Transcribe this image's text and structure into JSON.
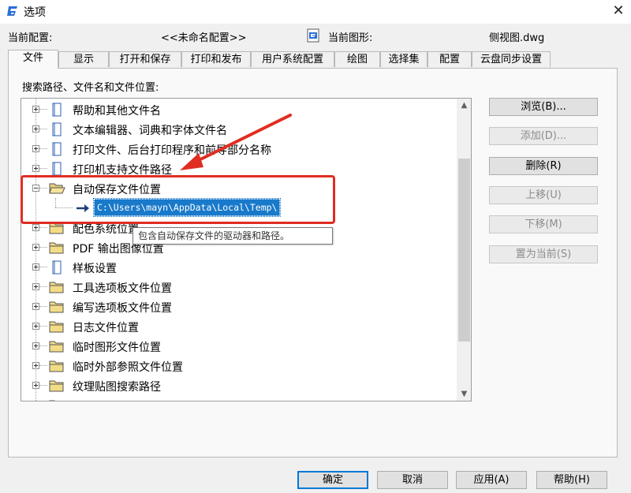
{
  "window": {
    "title": "选项",
    "close_label": "✕"
  },
  "header": {
    "current_profile_label": "当前配置:",
    "current_profile_value": "<<未命名配置>>",
    "current_drawing_label": "当前图形:",
    "current_drawing_value": "侧视图.dwg"
  },
  "tabs": [
    {
      "label": "文件"
    },
    {
      "label": "显示"
    },
    {
      "label": "打开和保存"
    },
    {
      "label": "打印和发布"
    },
    {
      "label": "用户系统配置"
    },
    {
      "label": "绘图"
    },
    {
      "label": "选择集"
    },
    {
      "label": "配置"
    },
    {
      "label": "云盘同步设置"
    }
  ],
  "files": {
    "section_label": "搜索路径、文件名和文件位置:",
    "tree": [
      {
        "label": "帮助和其他文件名",
        "icon": "document-icon",
        "expanded": false
      },
      {
        "label": "文本编辑器、词典和字体文件名",
        "icon": "document-icon",
        "expanded": false
      },
      {
        "label": "打印文件、后台打印程序和前导部分名称",
        "icon": "document-icon",
        "expanded": false
      },
      {
        "label": "打印机支持文件路径",
        "icon": "document-icon",
        "expanded": false
      },
      {
        "label": "自动保存文件位置",
        "icon": "folder-open-icon",
        "expanded": true
      },
      {
        "label": "配色系统位置",
        "icon": "folder-icon",
        "expanded": false
      },
      {
        "label": "PDF 输出图像位置",
        "icon": "folder-icon",
        "expanded": false
      },
      {
        "label": "样板设置",
        "icon": "document-icon",
        "expanded": false
      },
      {
        "label": "工具选项板文件位置",
        "icon": "folder-icon",
        "expanded": false
      },
      {
        "label": "编写选项板文件位置",
        "icon": "folder-icon",
        "expanded": false
      },
      {
        "label": "日志文件位置",
        "icon": "folder-icon",
        "expanded": false
      },
      {
        "label": "临时图形文件位置",
        "icon": "folder-icon",
        "expanded": false
      },
      {
        "label": "临时外部参照文件位置",
        "icon": "folder-icon",
        "expanded": false
      },
      {
        "label": "纹理贴图搜索路径",
        "icon": "folder-icon",
        "expanded": false
      },
      {
        "label": "",
        "icon": "folder-icon",
        "expanded": false
      }
    ],
    "autosave_path": "C:\\Users\\mayn\\AppData\\Local\\Temp\\",
    "tooltip": "包含自动保存文件的驱动器和路径。"
  },
  "side_buttons": {
    "browse": "浏览(B)...",
    "add": "添加(D)...",
    "delete": "删除(R)",
    "move_up": "上移(U)",
    "move_down": "下移(M)",
    "set_current": "置为当前(S)"
  },
  "bottom_buttons": {
    "ok": "确定",
    "cancel": "取消",
    "apply": "应用(A)",
    "help": "帮助(H)"
  },
  "colors": {
    "accent": "#0078d7",
    "selection": "#1979ca",
    "annotation_red": "#e02d22",
    "app_icon": "#2a6fd6"
  }
}
